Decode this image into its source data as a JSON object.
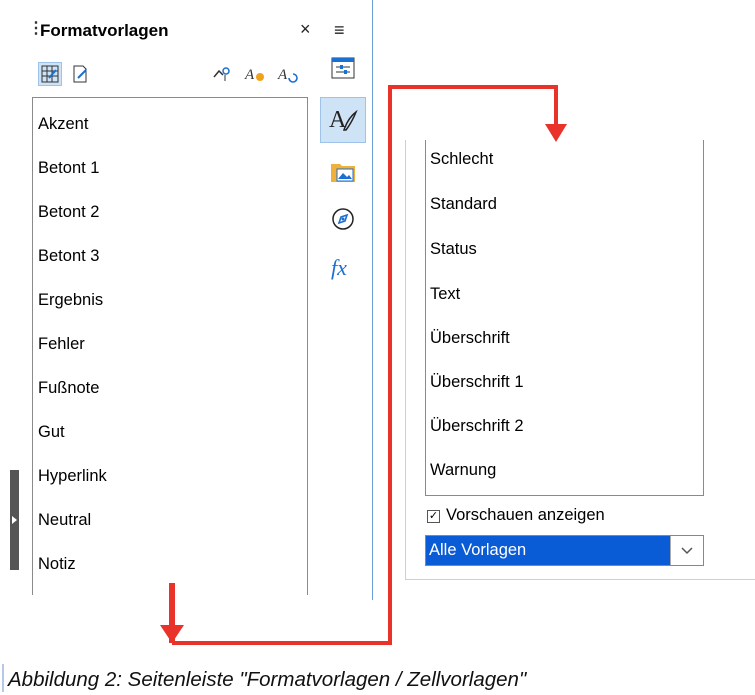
{
  "left_panel": {
    "title": "Formatvorlagen",
    "close_glyph": "×",
    "menu_glyph": "≡",
    "toolbar_icons": [
      "cell-styles-icon",
      "page-styles-icon",
      "fill-format-icon",
      "new-style-icon",
      "update-style-icon"
    ],
    "deck_icons": [
      "properties-icon",
      "styles-icon",
      "gallery-icon",
      "navigator-icon",
      "functions-icon"
    ],
    "items": [
      "Akzent",
      "Betont 1",
      "Betont 2",
      "Betont 3",
      "Ergebnis",
      "Fehler",
      "Fußnote",
      "Gut",
      "Hyperlink",
      "Neutral",
      "Notiz"
    ]
  },
  "right_panel": {
    "items": [
      "Schlecht",
      "Standard",
      "Status",
      "Text",
      "Überschrift",
      "Überschrift 1",
      "Überschrift 2",
      "Warnung"
    ],
    "preview_checkbox_label": "Vorschauen anzeigen",
    "preview_checked": true,
    "filter_value": "Alle Vorlagen"
  },
  "caption": "Abbildung 2: Seitenleiste \"Formatvorlagen / Zellvorlagen\"",
  "colors": {
    "arrow": "#e8322a",
    "selection": "#0a5bd6",
    "panel_accent": "#6aa0d8"
  }
}
